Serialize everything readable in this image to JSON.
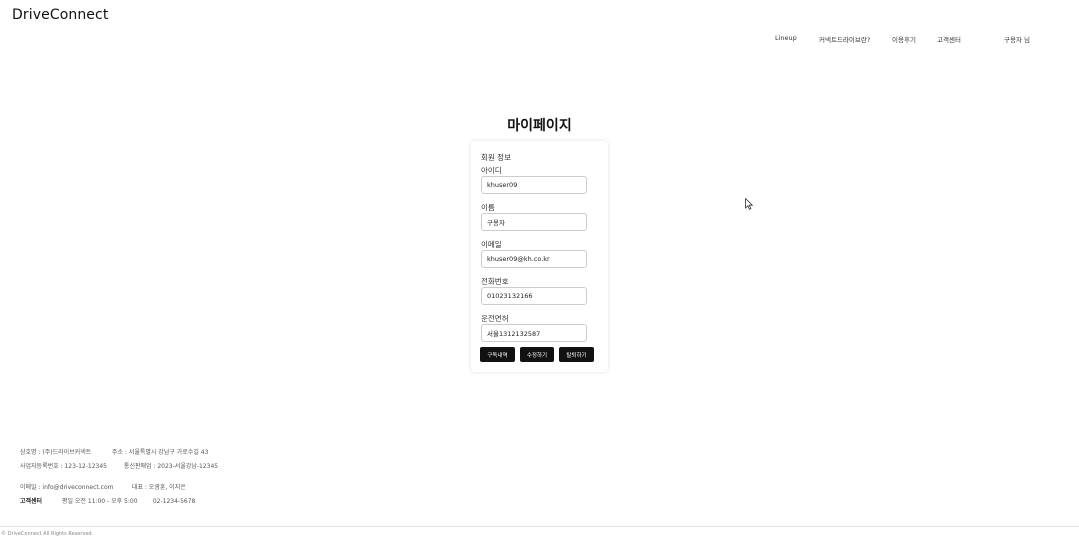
{
  "header": {
    "brand": "DriveConnect",
    "nav": [
      "Lineup",
      "커넥트드라이브란?",
      "이용후기",
      "고객센터"
    ],
    "user_greeting": "구용자 님"
  },
  "main": {
    "title": "마이페이지",
    "section_title": "회원 정보",
    "fields": [
      {
        "label": "아이디",
        "value": "khuser09"
      },
      {
        "label": "이름",
        "value": "구용자"
      },
      {
        "label": "이메일",
        "value": "khuser09@kh.co.kr"
      },
      {
        "label": "전화번호",
        "value": "01023132166"
      },
      {
        "label": "운전면허",
        "value": "서울1312132587"
      }
    ],
    "buttons": [
      "구독내역",
      "수정하기",
      "탈퇴하기"
    ]
  },
  "footer": {
    "row1": {
      "company": "상호명 : (주)드라이브커넥트",
      "address": "주소 : 서울특별시 강남구 가로수길 43"
    },
    "row2": {
      "biz_no": "사업자등록번호 : 123-12-12345",
      "ecommerce": "통신판매업 : 2023-서울강남-12345"
    },
    "row3": {
      "email": "이메일 : info@driveconnect.com",
      "ceo": "대표 : 오광훈, 이지은"
    },
    "row4": {
      "cs_label": "고객센터",
      "hours": "평일 오전 11:00 - 오후 5:00",
      "phone": "02-1234-5678"
    },
    "copyright": "© DriveConnect All Rights Reserved."
  },
  "colors": {
    "button_bg": "#111111",
    "button_text": "#ffffff",
    "input_border": "#cccccc"
  }
}
